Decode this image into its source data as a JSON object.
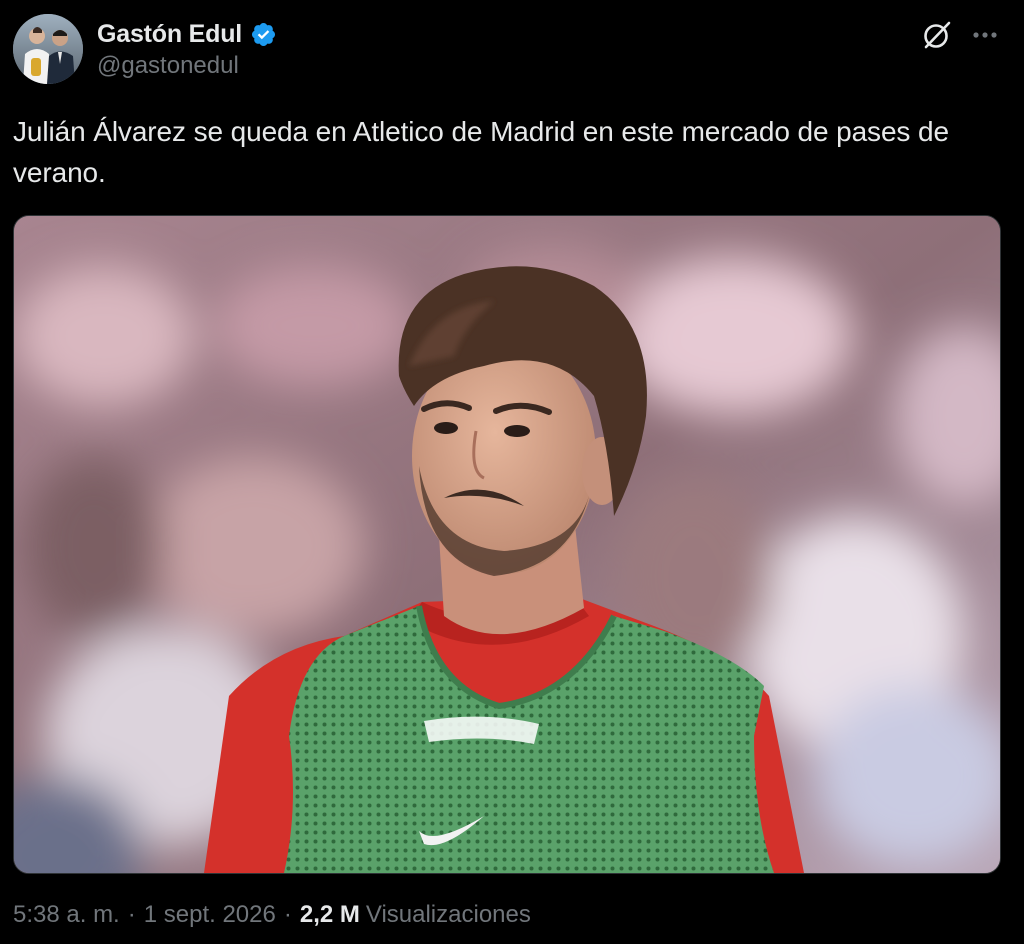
{
  "author": {
    "display_name": "Gastón Edul",
    "handle": "@gastonedul",
    "verified": true,
    "verified_color": "#1d9bf0",
    "avatar_icon": "avatar"
  },
  "header_actions": {
    "grok_icon": "grok-icon",
    "more_icon": "more-horizontal-icon"
  },
  "tweet": {
    "text": "Julián Álvarez se queda en Atletico de Madrid en este mercado de pases de verano.",
    "media": {
      "type": "photo"
    }
  },
  "meta": {
    "time": "5:38 a. m.",
    "separator": "·",
    "date": "1 sept. 2026",
    "views_count": "2,2 M",
    "views_label": "Visualizaciones"
  },
  "colors": {
    "background": "#000000",
    "primary_text": "#e7e9ea",
    "secondary_text": "#71767b"
  }
}
